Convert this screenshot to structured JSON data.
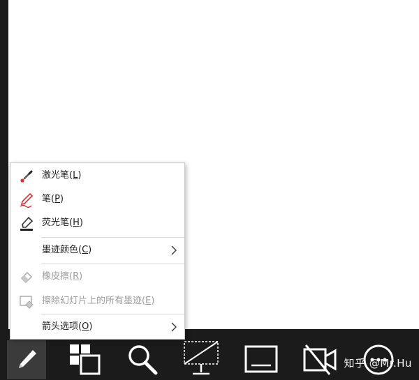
{
  "menu": {
    "items": [
      {
        "text": "激光笔",
        "key": "L",
        "icon": "laser-pointer-icon",
        "disabled": false
      },
      {
        "text": "笔",
        "key": "P",
        "icon": "pen-icon",
        "disabled": false
      },
      {
        "text": "荧光笔",
        "key": "H",
        "icon": "highlighter-icon",
        "disabled": false
      },
      {
        "text": "墨迹颜色",
        "key": "C",
        "submenu": true,
        "disabled": false
      },
      {
        "text": "橡皮擦",
        "key": "R",
        "icon": "eraser-icon",
        "disabled": true
      },
      {
        "text": "擦除幻灯片上的所有墨迹",
        "key": "E",
        "icon": "erase-all-ink-icon",
        "disabled": true
      },
      {
        "text": "箭头选项",
        "key": "O",
        "submenu": true,
        "disabled": false
      }
    ]
  },
  "toolbar": {
    "tools": [
      {
        "name": "pen-tool",
        "icon": "pen-icon"
      },
      {
        "name": "see-all-slides",
        "icon": "slides-grid-icon"
      },
      {
        "name": "zoom",
        "icon": "magnifier-icon"
      },
      {
        "name": "black-screen",
        "icon": "screen-toggle-icon"
      },
      {
        "name": "subtitles",
        "icon": "subtitles-icon"
      },
      {
        "name": "camera",
        "icon": "camera-off-icon"
      },
      {
        "name": "more-options",
        "icon": "more-icon"
      }
    ]
  },
  "watermark": "知乎 @Mr.Hu",
  "colors": {
    "laser": "#d13438",
    "pen": "#d13438",
    "toolbar_bg": "#1b1b1b",
    "disabled_text": "#9c9c9c"
  }
}
